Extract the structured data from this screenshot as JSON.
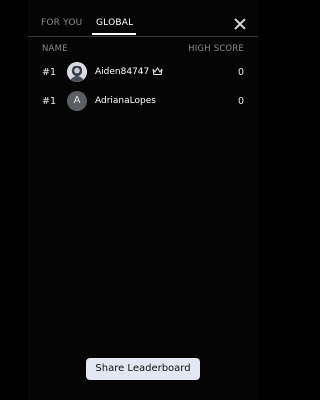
{
  "tabs": [
    {
      "label": "FOR YOU",
      "active": false
    },
    {
      "label": "GLOBAL",
      "active": true
    }
  ],
  "columns": {
    "name": "NAME",
    "score": "HIGH SCORE"
  },
  "rows": [
    {
      "rank": "#1",
      "avatar": "photo",
      "username": "Aiden84747",
      "badge": "crown-icon",
      "score": "0"
    },
    {
      "rank": "#1",
      "avatar": "A",
      "username": "AdrianaLopes",
      "score": "0"
    }
  ],
  "share_button": "Share Leaderboard",
  "colors": {
    "background": "#000000",
    "button_bg": "#e3e7f1",
    "muted_text": "#8a8a8a"
  }
}
